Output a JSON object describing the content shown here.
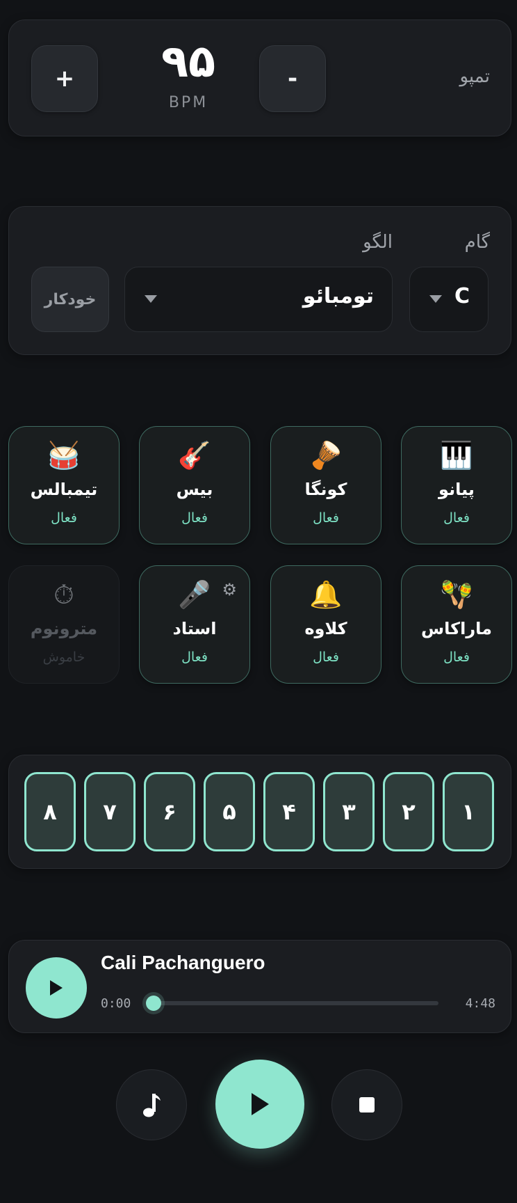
{
  "tempo": {
    "label": "تمپو",
    "value": "۹۵",
    "unit": "BPM",
    "plus_label": "+",
    "minus_label": "-"
  },
  "key_section": {
    "key_label": "گام",
    "key_value": "C",
    "pattern_label": "الگو",
    "pattern_value": "تومبائو",
    "auto_label": "خودکار"
  },
  "instruments": [
    {
      "icon": "piano-icon",
      "glyph": "🎹",
      "name": "پیانو",
      "status": "فعال",
      "active": true
    },
    {
      "icon": "conga-icon",
      "glyph": "🪘",
      "name": "کونگا",
      "status": "فعال",
      "active": true
    },
    {
      "icon": "guitar-icon",
      "glyph": "🎸",
      "name": "بیس",
      "status": "فعال",
      "active": true
    },
    {
      "icon": "drum-icon",
      "glyph": "🥁",
      "name": "تیمبالس",
      "status": "فعال",
      "active": true
    },
    {
      "icon": "maracas-icon",
      "glyph": "🪇",
      "name": "ماراکاس",
      "status": "فعال",
      "active": true
    },
    {
      "icon": "bell-icon",
      "glyph": "🔔",
      "name": "کلاوه",
      "status": "فعال",
      "active": true
    },
    {
      "icon": "microphone-icon",
      "glyph": "🎤",
      "name": "استاد",
      "status": "فعال",
      "active": true,
      "settings_icon": "gear-icon",
      "settings_glyph": "⚙"
    },
    {
      "icon": "stopwatch-icon",
      "glyph": "⏱",
      "name": "مترونوم",
      "status": "خاموش",
      "active": false
    }
  ],
  "steps": [
    "۱",
    "۲",
    "۳",
    "۴",
    "۵",
    "۶",
    "۷",
    "۸"
  ],
  "player": {
    "title": "Cali Pachanguero",
    "current_time": "0:00",
    "total_time": "4:48",
    "progress": 0,
    "play_icon": "play-icon"
  },
  "transport": {
    "note_icon": "music-note-icon",
    "note_glyph": "♩",
    "play_icon": "play-icon",
    "stop_icon": "stop-icon"
  },
  "colors": {
    "accent": "#8fe6cf",
    "background": "#111316",
    "card": "#1b1d21",
    "active_text": "#7ee3c5"
  }
}
